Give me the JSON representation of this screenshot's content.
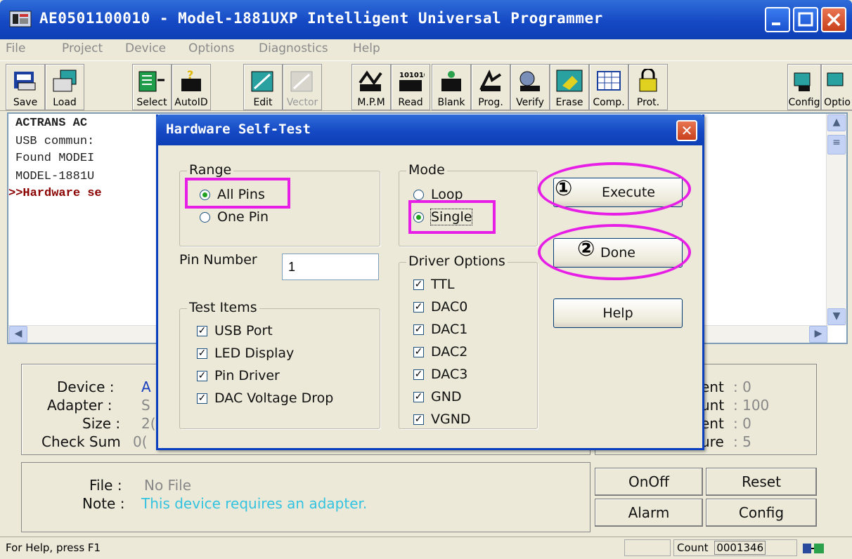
{
  "window": {
    "title": "AE0501100010 - Model-1881UXP Intelligent Universal Programmer",
    "icon": "programmer-app-icon"
  },
  "menu": [
    "File",
    "Project",
    "Device",
    "Options",
    "Diagnostics",
    "Help"
  ],
  "toolbar": [
    {
      "label": "Save",
      "icon": "save-icon"
    },
    {
      "label": "Load",
      "icon": "load-icon"
    },
    {
      "label": "Select",
      "icon": "select-icon"
    },
    {
      "label": "AutoID",
      "icon": "autoid-icon"
    },
    {
      "label": "Edit",
      "icon": "edit-icon"
    },
    {
      "label": "Vector",
      "icon": "vector-icon",
      "disabled": true
    },
    {
      "label": "M.P.M",
      "icon": "mpm-icon"
    },
    {
      "label": "Read",
      "icon": "read-icon"
    },
    {
      "label": "Blank",
      "icon": "blank-icon"
    },
    {
      "label": "Prog.",
      "icon": "program-icon"
    },
    {
      "label": "Verify",
      "icon": "verify-icon"
    },
    {
      "label": "Erase",
      "icon": "erase-icon"
    },
    {
      "label": "Comp.",
      "icon": "compare-icon"
    },
    {
      "label": "Prot.",
      "icon": "protect-icon"
    },
    {
      "label": "Config",
      "icon": "config-icon"
    },
    {
      "label": "Optio",
      "icon": "options-icon"
    }
  ],
  "log": [
    "ACTRANS AC",
    "USB commun:",
    "Found MODEI",
    "MODEL-1881U",
    ">>Hardware se"
  ],
  "info": {
    "device_label": "Device :",
    "device_value": "A",
    "adapter_label": "Adapter :",
    "adapter_value": "S",
    "size_label": "Size :",
    "size_value": "2(",
    "checksum_label": "Check Sum",
    "checksum_value": "0(",
    "right": [
      {
        "label": "ent",
        "value": ": 0"
      },
      {
        "label": "unt",
        "value": ": 100"
      },
      {
        "label": "ent",
        "value": ": 0"
      },
      {
        "label": "ure",
        "value": ": 5"
      }
    ]
  },
  "file": {
    "file_label": "File :",
    "file_value": "No File",
    "note_label": "Note :",
    "note_value": "This device requires an adapter.",
    "note_color": "#33c3e0"
  },
  "panel_buttons": {
    "onoff": "OnOff",
    "reset": "Reset",
    "alarm": "Alarm",
    "config": "Config"
  },
  "status": {
    "help": "For Help, press F1",
    "count_label": "Count",
    "count_value": "0001346"
  },
  "dialog": {
    "title": "Hardware Self-Test",
    "range": {
      "title": "Range",
      "options": [
        "All Pins",
        "One Pin"
      ],
      "selected": "All Pins"
    },
    "mode": {
      "title": "Mode",
      "options": [
        "Loop",
        "Single"
      ],
      "selected": "Single"
    },
    "pin_number": {
      "label": "Pin Number",
      "value": "1"
    },
    "test_items": {
      "title": "Test Items",
      "items": [
        "USB Port",
        "LED Display",
        "Pin Driver",
        "DAC Voltage Drop"
      ]
    },
    "driver_options": {
      "title": "Driver Options",
      "items": [
        "TTL",
        "DAC0",
        "DAC1",
        "DAC2",
        "DAC3",
        "GND",
        "VGND"
      ]
    },
    "buttons": {
      "execute": "Execute",
      "done": "Done",
      "help": "Help"
    },
    "annotations": {
      "step1": "①",
      "step2": "②",
      "highlight_color": "#e61ee6"
    }
  }
}
